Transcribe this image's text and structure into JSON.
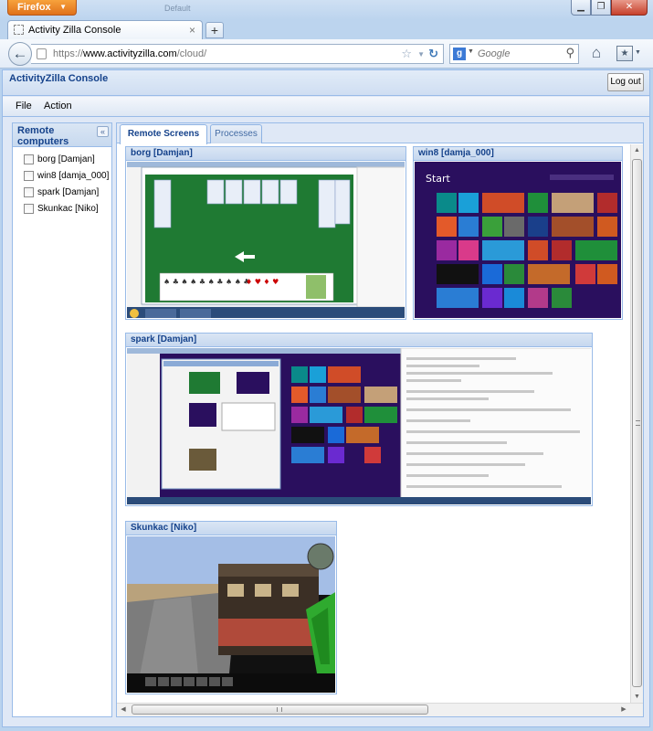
{
  "browser": {
    "menu_button": "Firefox",
    "ghost_tab": "Default",
    "tab_title": "Activity Zilla Console",
    "new_tab": "+",
    "url_scheme": "https://",
    "url_host": "www.activityzilla.com",
    "url_path": "/cloud/",
    "search_placeholder": "Google"
  },
  "app": {
    "title": "ActivityZilla Console",
    "logout_label": "Log out",
    "menu": [
      "File",
      "Action"
    ]
  },
  "sidebar": {
    "title": "Remote computers",
    "computers": [
      {
        "label": "borg [Damjan]",
        "checked": false
      },
      {
        "label": "win8 [damja_000]",
        "checked": false
      },
      {
        "label": "spark [Damjan]",
        "checked": false
      },
      {
        "label": "Skunkac [Niko]",
        "checked": false
      }
    ]
  },
  "main": {
    "tabs": [
      {
        "label": "Remote Screens",
        "active": true
      },
      {
        "label": "Processes",
        "active": false
      }
    ],
    "screens": [
      {
        "title": "borg [Damjan]",
        "content": "solitaire-desktop"
      },
      {
        "title": "win8 [damja_000]",
        "content": "windows8-start"
      },
      {
        "title": "spark [Damjan]",
        "content": "nested-desktop"
      },
      {
        "title": "Skunkac [Niko]",
        "content": "minecraft-game"
      }
    ],
    "win8_start_label": "Start"
  },
  "colors": {
    "panel_border": "#99bbe8",
    "header_text": "#15428b",
    "felt_green": "#1f7a33",
    "win8_bg": "#2a0f5e"
  }
}
